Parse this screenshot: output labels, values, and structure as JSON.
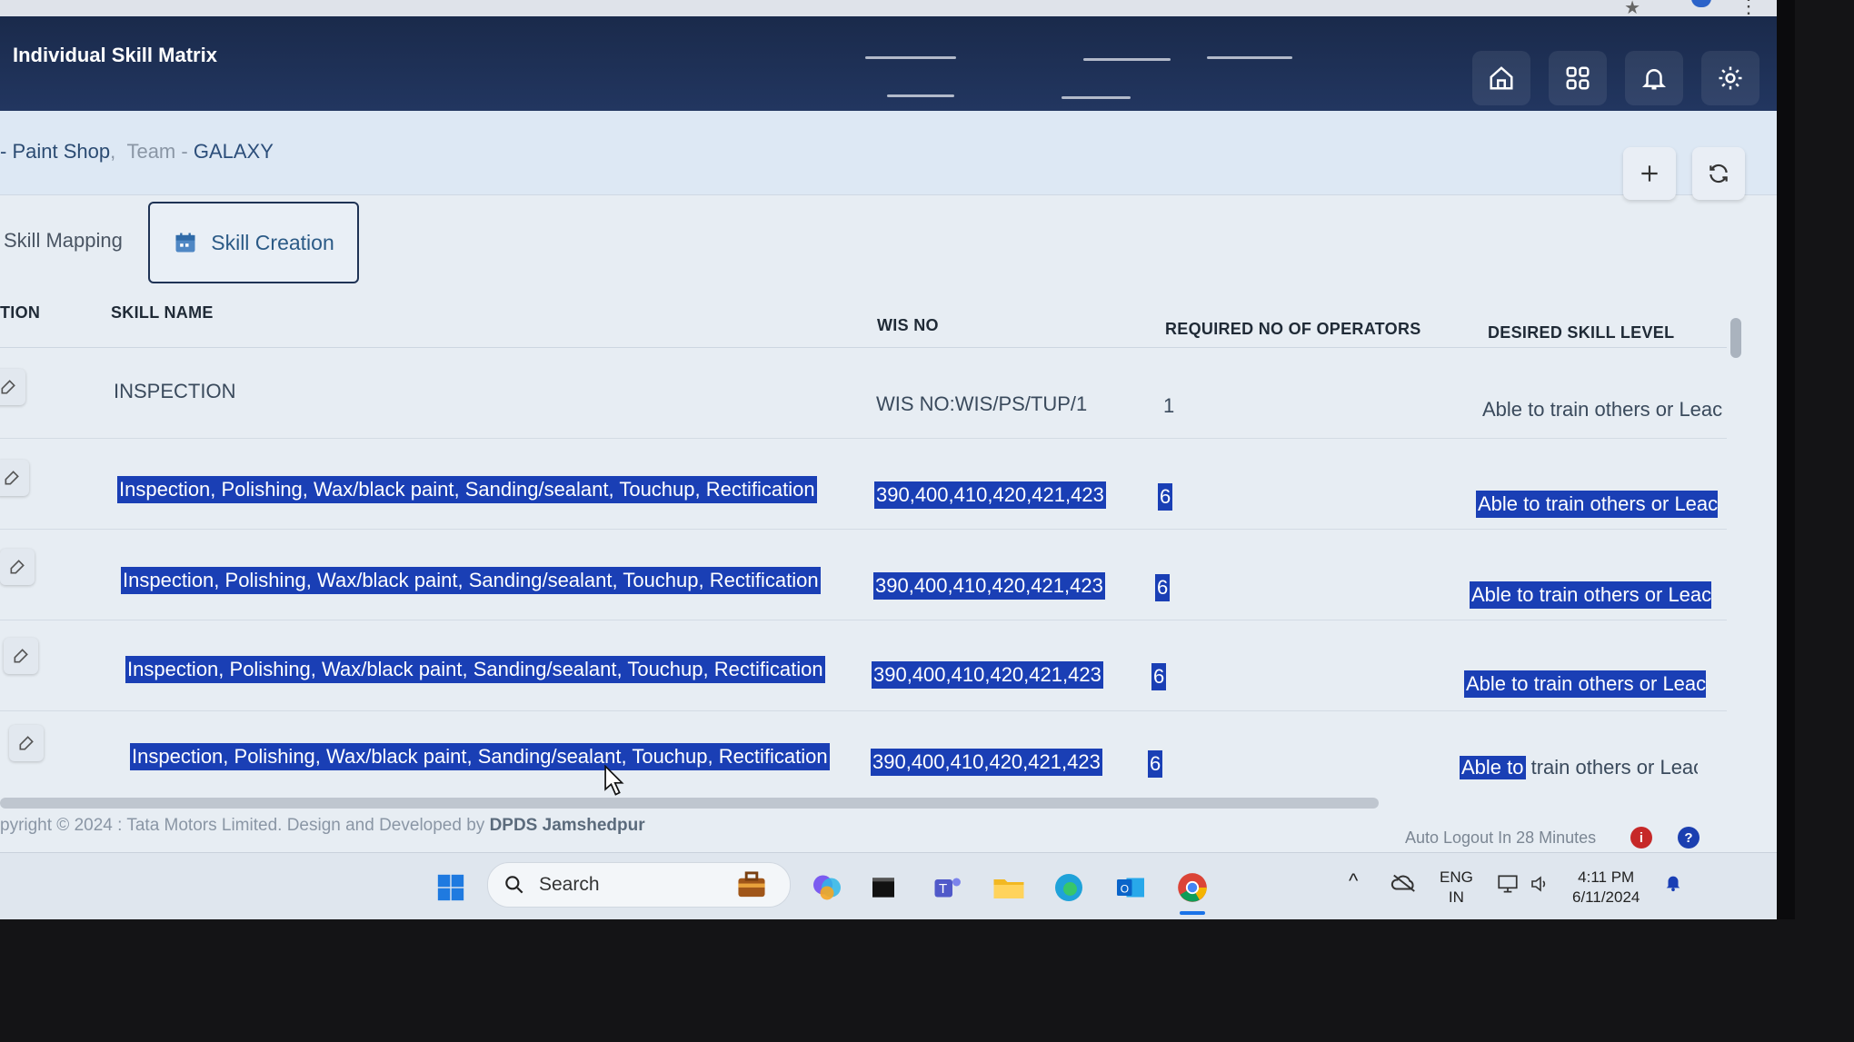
{
  "app": {
    "title": "Individual Skill Matrix"
  },
  "breadcrumb": {
    "shop": "Paint Shop",
    "sep": ",",
    "team_label": "Team -",
    "team": "GALAXY"
  },
  "tabs": [
    {
      "label": "Skill Mapping"
    },
    {
      "label": "Skill Creation"
    }
  ],
  "table": {
    "columns": {
      "action": "TION",
      "skill_name": "SKILL NAME",
      "wis_no": "WIS NO",
      "required": "REQUIRED NO OF OPERATORS",
      "desired": "DESIRED SKILL LEVEL"
    },
    "rows": [
      {
        "skill_name": "INSPECTION",
        "wis_no": "WIS NO:WIS/PS/TUP/1",
        "required": "1",
        "desired": "Able to train others or Leac"
      },
      {
        "skill_name": "Inspection, Polishing, Wax/black paint, Sanding/sealant, Touchup, Rectification",
        "wis_no": "390,400,410,420,421,423",
        "required": "6",
        "desired": "Able to train others or Leac"
      },
      {
        "skill_name": "Inspection, Polishing, Wax/black paint, Sanding/sealant, Touchup, Rectification",
        "wis_no": "390,400,410,420,421,423",
        "required": "6",
        "desired": "Able to train others or Leac"
      },
      {
        "skill_name": "Inspection, Polishing, Wax/black paint, Sanding/sealant, Touchup, Rectification",
        "wis_no": "390,400,410,420,421,423",
        "required": "6",
        "desired": "Able to train others or Leac"
      },
      {
        "skill_name": "Inspection, Polishing, Wax/black paint, Sanding/sealant, Touchup, Rectification",
        "wis_no": "390,400,410,420,421,423",
        "required": "6",
        "desired_sel": "Able to",
        "desired_rest": " train others or Leac"
      }
    ]
  },
  "footer": {
    "copyright": "pyright © 2024 : Tata Motors Limited.  Design and Developed by",
    "developer": "DPDS Jamshedpur",
    "auto_logout": "Auto Logout In 28 Minutes",
    "info_badge": "i",
    "help_badge": "?"
  },
  "taskbar": {
    "search_placeholder": "Search",
    "lang_top": "ENG",
    "lang_bottom": "IN",
    "time": "4:11 PM",
    "date": "6/11/2024"
  },
  "colors": {
    "header": "#1a2a4b",
    "selection": "#1a3fb5",
    "accent": "#2b5a86"
  },
  "icons": [
    "home-icon",
    "grid-icon",
    "bell-icon",
    "settings-icon",
    "plus-icon",
    "refresh-icon",
    "calendar-icon",
    "edit-icon"
  ]
}
